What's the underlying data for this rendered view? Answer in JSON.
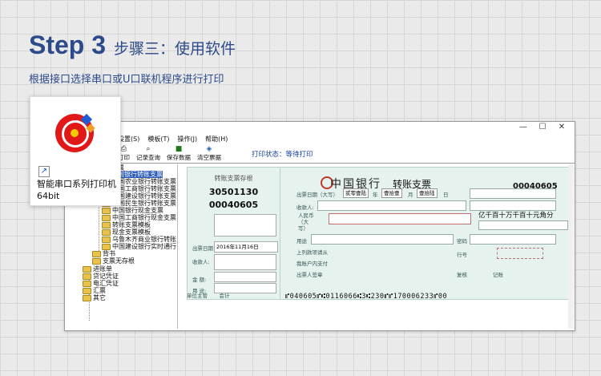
{
  "header": {
    "step": "Step 3",
    "step_sub": "步骤三：使用软件",
    "subtitle": "根据接口选择串口或U口联机程序进行打印"
  },
  "desktop_icon": {
    "label": "智能串口系列打印机64bit"
  },
  "window": {
    "controls": [
      "—",
      "☐",
      "✕"
    ],
    "menu": [
      "设置(S)",
      "模板(T)",
      "操作(J)",
      "帮助(H)"
    ],
    "toolbar": [
      {
        "label": "打印",
        "icon": "print-icon"
      },
      {
        "label": "记录查询",
        "icon": "search-icon"
      },
      {
        "label": "保存数据",
        "icon": "save-icon"
      },
      {
        "label": "清空票据",
        "icon": "clear-icon"
      }
    ],
    "print_status": "打印状态：等待打印"
  },
  "tree": {
    "root": "支票",
    "items": [
      "中国银行转账支票",
      "中国农业银行转账支票",
      "中国工商银行转账支票",
      "中国建设银行转账支票",
      "中国民生银行转账支票",
      "中国银行现金支票",
      "中国工商银行现金支票",
      "转账支票模板",
      "现金支票模板",
      "乌鲁木齐商业银行转账",
      "中国建设银行实时通行"
    ],
    "after_sub": [
      "背书",
      "支票无存根"
    ],
    "groups": [
      "进账单",
      "贷记凭证",
      "电汇凭证",
      "汇票",
      "其它"
    ]
  },
  "stub": {
    "title": "转账支票存根",
    "code": "30501130",
    "number": "00040605",
    "date_label": "出票日期",
    "date_value": "2016年11月16日",
    "payee_label": "收款人:",
    "amount_label": "金  额:",
    "usage_label": "用  途:",
    "manager_label": "单位主管",
    "accountant_label": "会计"
  },
  "check": {
    "bank": "中国银行",
    "title": "转账支票",
    "number": "00040605",
    "date_label": "出票日期（大写）",
    "year": "贰零壹陆",
    "year_unit": "年",
    "month": "壹拾壹",
    "month_unit": "月",
    "day": "壹拾陆",
    "day_unit": "日",
    "payee_label": "收款人:",
    "amount_label": "人民币（大写）",
    "amount_units": "亿千百十万千百十元角分",
    "usage_label": "用途",
    "password_label": "密码",
    "line_label": "行号",
    "remark1": "上列款项请从",
    "remark2": "我账户内支付",
    "drawer": "出票人签章",
    "verify": "复核",
    "bookkeeper": "记账",
    "micr": "⑈040605⑈⑆0116066⑆3⑆230⑈⑈170006233⑈00"
  }
}
